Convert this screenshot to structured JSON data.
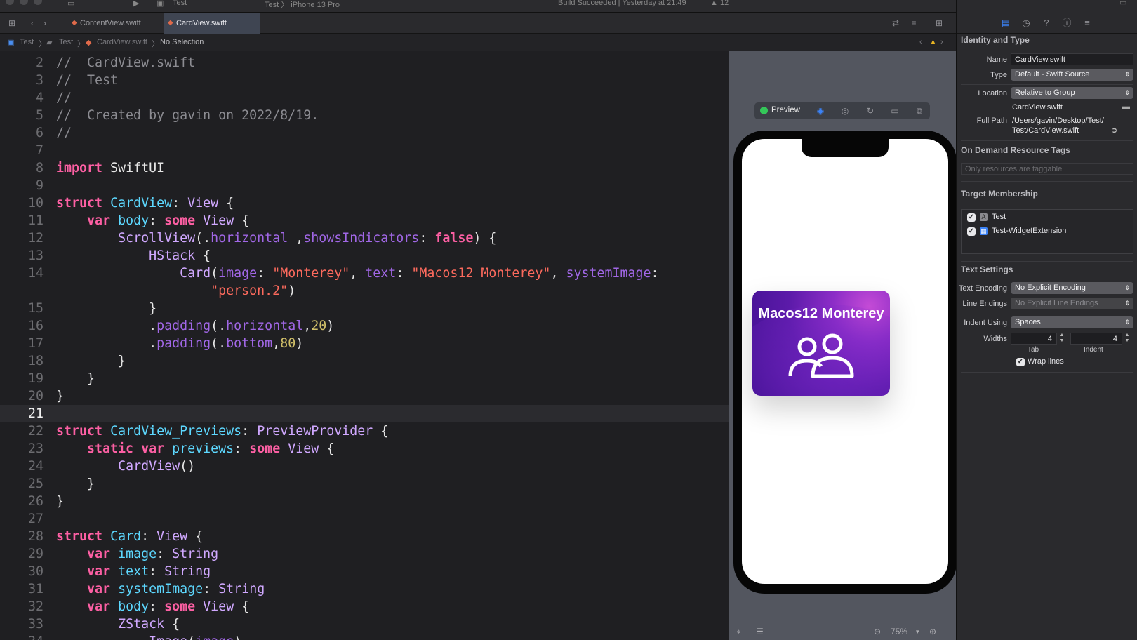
{
  "window": {
    "toolbar_title": "Test",
    "scheme_text": "Test 〉 iPhone 13 Pro",
    "status_text": "Build Succeeded | Yesterday at 21:49",
    "warning_count": "12"
  },
  "tabs": [
    {
      "label": "ContentView.swift",
      "active": false
    },
    {
      "label": "CardView.swift",
      "active": true
    }
  ],
  "jumpbar": {
    "project": "Test",
    "group": "Test",
    "file": "CardView.swift",
    "selection": "No Selection"
  },
  "editor": {
    "current_line": "21",
    "lines": [
      {
        "n": "2",
        "html": "<span class=\"cm\">//  CardView.swift</span>"
      },
      {
        "n": "3",
        "html": "<span class=\"cm\">//  Test</span>"
      },
      {
        "n": "4",
        "html": "<span class=\"cm\">//</span>"
      },
      {
        "n": "5",
        "html": "<span class=\"cm\">//  Created by gavin on 2022/8/19.</span>"
      },
      {
        "n": "6",
        "html": "<span class=\"cm\">//</span>"
      },
      {
        "n": "7",
        "html": ""
      },
      {
        "n": "8",
        "html": "<span class=\"kw\">import</span> SwiftUI"
      },
      {
        "n": "9",
        "html": ""
      },
      {
        "n": "10",
        "html": "<span class=\"kw\">struct</span> <span class=\"tn\">CardView</span>: <span class=\"ty\">View</span> {"
      },
      {
        "n": "11",
        "html": "    <span class=\"kw\">var</span> <span class=\"tn\">body</span>: <span class=\"kw\">some</span> <span class=\"ty\">View</span> {"
      },
      {
        "n": "12",
        "html": "        <span class=\"ty\">ScrollView</span>(.<span class=\"fn\">horizontal</span> ,<span class=\"fn\">showsIndicators</span>: <span class=\"kw\">false</span>) {"
      },
      {
        "n": "13",
        "html": "            <span class=\"ty\">HStack</span> {"
      },
      {
        "n": "14",
        "html": "                <span class=\"ty\">Card</span>(<span class=\"fn\">image</span>: <span class=\"str\">\"Monterey\"</span>, <span class=\"fn\">text</span>: <span class=\"str\">\"Macos12 Monterey\"</span>, <span class=\"fn\">systemImage</span>:"
      },
      {
        "n": "",
        "html": "                    <span class=\"str\">\"person.2\"</span>)"
      },
      {
        "n": "15",
        "html": "            }"
      },
      {
        "n": "16",
        "html": "            .<span class=\"fn\">padding</span>(.<span class=\"fn\">horizontal</span>,<span class=\"num\">20</span>)"
      },
      {
        "n": "17",
        "html": "            .<span class=\"fn\">padding</span>(.<span class=\"fn\">bottom</span>,<span class=\"num\">80</span>)"
      },
      {
        "n": "18",
        "html": "        }"
      },
      {
        "n": "19",
        "html": "    }"
      },
      {
        "n": "20",
        "html": "}"
      },
      {
        "n": "21",
        "html": ""
      },
      {
        "n": "22",
        "html": "<span class=\"kw\">struct</span> <span class=\"tn\">CardView_Previews</span>: <span class=\"ty\">PreviewProvider</span> {"
      },
      {
        "n": "23",
        "html": "    <span class=\"kw\">static var</span> <span class=\"tn\">previews</span>: <span class=\"kw\">some</span> <span class=\"ty\">View</span> {"
      },
      {
        "n": "24",
        "html": "        <span class=\"ty\">CardView</span>()"
      },
      {
        "n": "25",
        "html": "    }"
      },
      {
        "n": "26",
        "html": "}"
      },
      {
        "n": "27",
        "html": ""
      },
      {
        "n": "28",
        "html": "<span class=\"kw\">struct</span> <span class=\"tn\">Card</span>: <span class=\"ty\">View</span> {"
      },
      {
        "n": "29",
        "html": "    <span class=\"kw\">var</span> <span class=\"tn\">image</span>: <span class=\"ty\">String</span>"
      },
      {
        "n": "30",
        "html": "    <span class=\"kw\">var</span> <span class=\"tn\">text</span>: <span class=\"ty\">String</span>"
      },
      {
        "n": "31",
        "html": "    <span class=\"kw\">var</span> <span class=\"tn\">systemImage</span>: <span class=\"ty\">String</span>"
      },
      {
        "n": "32",
        "html": "    <span class=\"kw\">var</span> <span class=\"tn\">body</span>: <span class=\"kw\">some</span> <span class=\"ty\">View</span> {"
      },
      {
        "n": "33",
        "html": "        <span class=\"ty\">ZStack</span> {"
      },
      {
        "n": "34",
        "html": "            <span class=\"ty\">Image</span>(<span class=\"fn\">image</span>)"
      }
    ]
  },
  "preview": {
    "label": "Preview",
    "card_title": "Macos12 Monterey",
    "card_icon": "person-2-icon",
    "zoom": "75%"
  },
  "inspector": {
    "identity_title": "Identity and Type",
    "name_label": "Name",
    "name_value": "CardView.swift",
    "type_label": "Type",
    "type_value": "Default - Swift Source",
    "location_label": "Location",
    "location_value": "Relative to Group",
    "location_file": "CardView.swift",
    "fullpath_label": "Full Path",
    "fullpath_value_1": "/Users/gavin/Desktop/Test/",
    "fullpath_value_2": "Test/CardView.swift",
    "odr_title": "On Demand Resource Tags",
    "odr_placeholder": "Only resources are taggable",
    "target_title": "Target Membership",
    "targets": [
      {
        "label": "Test",
        "checked": true
      },
      {
        "label": "Test-WidgetExtension",
        "checked": true
      }
    ],
    "text_settings_title": "Text Settings",
    "encoding_label": "Text Encoding",
    "encoding_value": "No Explicit Encoding",
    "line_endings_label": "Line Endings",
    "line_endings_value": "No Explicit Line Endings",
    "indent_using_label": "Indent Using",
    "indent_using_value": "Spaces",
    "widths_label": "Widths",
    "tab_width": "4",
    "indent_width": "4",
    "tab_caption": "Tab",
    "indent_caption": "Indent",
    "wrap_label": "Wrap lines"
  },
  "colors": {
    "accent": "#3b82f6",
    "keyword": "#fc5fa3",
    "type": "#d0a8ff",
    "string": "#fc6a5d",
    "number": "#d0bf69"
  }
}
